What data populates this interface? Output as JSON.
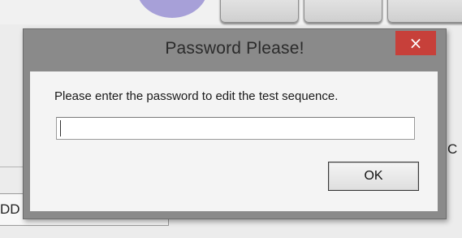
{
  "background": {
    "right_text": "C",
    "left_text": "DD"
  },
  "dialog": {
    "title": "Password Please!",
    "close_label": "×",
    "prompt": "Please enter the password to edit the test sequence.",
    "password_value": "",
    "ok_label": "OK",
    "colors": {
      "frame": "#8a8a8a",
      "close": "#c7403a",
      "client": "#f4f4f4"
    }
  }
}
